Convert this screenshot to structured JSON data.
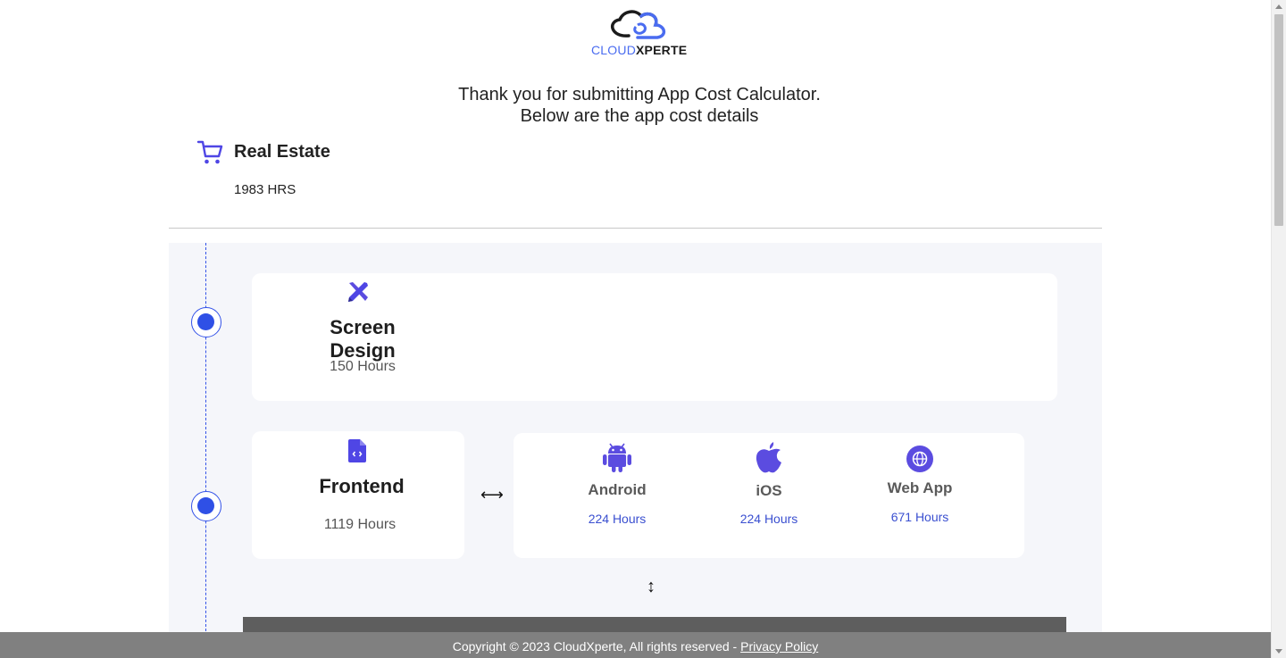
{
  "brand": {
    "name_part1": "CLOUD",
    "name_part2": "XPERTE",
    "accent_color": "#4a6cf0"
  },
  "header": {
    "line1": "Thank you for submitting App Cost Calculator.",
    "line2": "Below are the app cost details"
  },
  "app": {
    "icon": "cart-icon",
    "name": "Real Estate",
    "total_hours": "1983 HRS"
  },
  "screen_design": {
    "icon": "design-tools-icon",
    "title": "Screen Design",
    "hours": "150 Hours"
  },
  "frontend": {
    "icon": "code-file-icon",
    "title": "Frontend",
    "hours": "1119 Hours",
    "connector": "⟷",
    "down_connector": "↕",
    "platforms": [
      {
        "icon": "android-icon",
        "name": "Android",
        "hours": "224 Hours"
      },
      {
        "icon": "apple-icon",
        "name": "iOS",
        "hours": "224 Hours"
      },
      {
        "icon": "globe-icon",
        "name": "Web App",
        "hours": "671 Hours"
      }
    ]
  },
  "footer": {
    "copyright": "Copyright © 2023 CloudXperte, All rights reserved - ",
    "privacy_link": " Privacy Policy"
  }
}
